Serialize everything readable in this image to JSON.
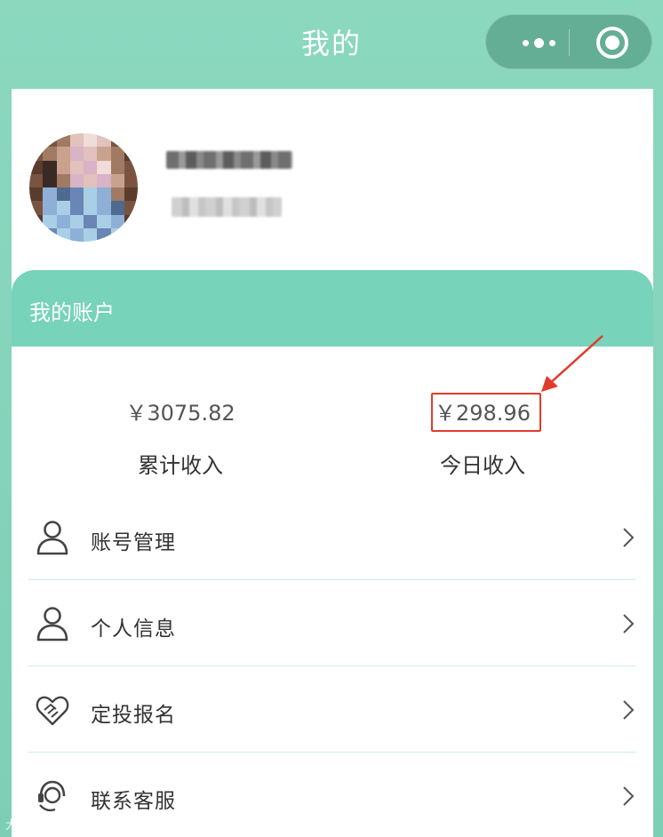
{
  "header": {
    "title": "我的",
    "more_icon": "more-dots-icon",
    "close_icon": "target-circle-icon"
  },
  "profile": {
    "avatar_icon": "avatar-pixelated"
  },
  "account": {
    "section_title": "我的账户",
    "total_income": {
      "amount": "￥3075.82",
      "label": "累计收入"
    },
    "today_income": {
      "amount": "￥298.96",
      "label": "今日收入"
    }
  },
  "menu": [
    {
      "label": "账号管理",
      "icon": "user-icon"
    },
    {
      "label": "个人信息",
      "icon": "user-icon"
    },
    {
      "label": "定投报名",
      "icon": "heart-handshake-icon"
    },
    {
      "label": "联系客服",
      "icon": "customer-service-icon"
    }
  ],
  "colors": {
    "accent": "#77d3b9",
    "highlight": "#e23b2e"
  },
  "watermark": "大数跨境"
}
